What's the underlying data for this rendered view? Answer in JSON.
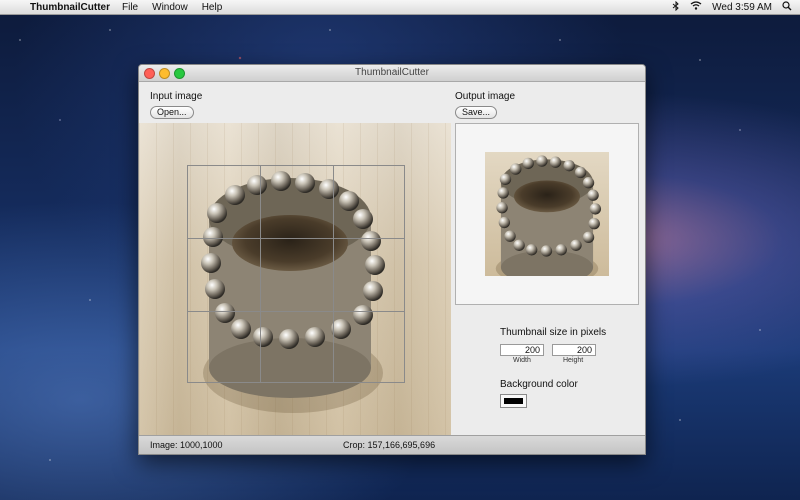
{
  "menubar": {
    "apple_glyph": "",
    "app_name": "ThumbnailCutter",
    "items": [
      "File",
      "Window",
      "Help"
    ],
    "clock": "Wed 3:59 AM"
  },
  "window": {
    "title": "ThumbnailCutter",
    "input_label": "Input image",
    "open_button": "Open...",
    "output_label": "Output image",
    "save_button": "Save...",
    "thumbnail": {
      "heading": "Thumbnail size in pixels",
      "width_value": "200",
      "height_value": "200",
      "width_label": "Width",
      "height_label": "Height"
    },
    "background": {
      "heading": "Background color",
      "color": "#000000"
    },
    "status": {
      "image": "Image: 1000,1000",
      "crop": "Crop: 157,166,695,696"
    }
  },
  "colors": {
    "accent_close": "#ff5f57",
    "accent_min": "#febc2e",
    "accent_max": "#28c840"
  }
}
